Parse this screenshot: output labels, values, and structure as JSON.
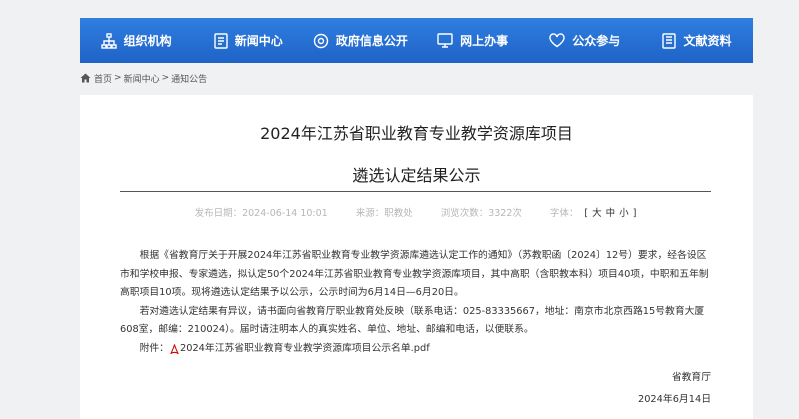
{
  "nav": {
    "items": [
      {
        "label": "组织机构",
        "icon": "org-chart-icon"
      },
      {
        "label": "新闻中心",
        "icon": "news-icon"
      },
      {
        "label": "政府信息公开",
        "icon": "info-open-icon"
      },
      {
        "label": "网上办事",
        "icon": "online-service-icon"
      },
      {
        "label": "公众参与",
        "icon": "heart-icon"
      },
      {
        "label": "文献资料",
        "icon": "document-icon"
      }
    ]
  },
  "breadcrumb": {
    "home": "首页",
    "sep": ">",
    "news": "新闻中心",
    "notice": "通知公告"
  },
  "article": {
    "title_line1": "2024年江苏省职业教育专业教学资源库项目",
    "title_line2": "遴选认定结果公示",
    "meta": {
      "publish_date": "发布日期：2024-06-14 10:01",
      "source": "来源：职教处",
      "views": "浏览次数：3322次",
      "font_label": "字体：",
      "open": "[",
      "large": "大",
      "medium": "中",
      "small": "小",
      "close": "]"
    },
    "paragraph1": "根据《省教育厅关于开展2024年江苏省职业教育专业教学资源库遴选认定工作的通知》（苏教职函〔2024〕12号）要求，经各设区市和学校申报、专家遴选，拟认定50个2024年江苏省职业教育专业教学资源库项目，其中高职（含职教本科）项目40项，中职和五年制高职项目10项。现将遴选认定结果予以公示，公示时间为6月14日—6月20日。",
    "paragraph2": "若对遴选认定结果有异议，请书面向省教育厅职业教育处反映（联系电话：025-83335667，地址：南京市北京西路15号教育大厦608室，邮编：210024）。届时请注明本人的真实姓名、单位、地址、邮编和电话，以便联系。",
    "attachment_label": "附件：",
    "attachment_file": "2024年江苏省职业教育专业教学资源库项目公示名单.pdf",
    "signature_org": "省教育厅",
    "signature_date": "2024年6月14日"
  },
  "colors": {
    "nav_bg": "#2a74d8",
    "page_bg": "#f0f1f3",
    "pdf_icon": "#cc0000"
  }
}
